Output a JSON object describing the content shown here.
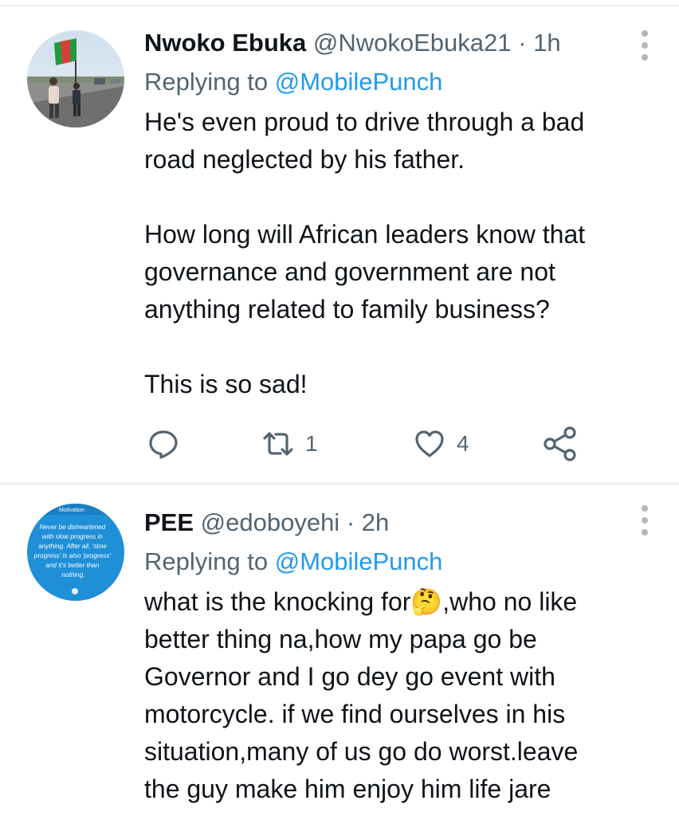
{
  "tweets": [
    {
      "display_name": "Nwoko Ebuka",
      "handle": "@NwokoEbuka21",
      "separator": "·",
      "time": "1h",
      "replying_prefix": "Replying to",
      "replying_to": "@MobilePunch",
      "lines": [
        "He's even proud to drive through a bad",
        "road neglected by his father.",
        "",
        "How long will African leaders know that",
        "governance and government are not",
        "anything related to family business?",
        "",
        "This is so sad!"
      ],
      "retweets": "1",
      "likes": "4",
      "icons": [
        "avatar-photo",
        "more-vertical-icon",
        "reply-icon",
        "retweet-icon",
        "like-icon",
        "share-icon"
      ]
    },
    {
      "display_name": "PEE",
      "handle": "@edoboyehi",
      "separator": "·",
      "time": "2h",
      "replying_prefix": "Replying to",
      "replying_to": "@MobilePunch",
      "lines": [
        "what is the knocking for🤔,who no like",
        "better thing na,how my papa go be",
        "Governor and I go dey go event with",
        "motorcycle. if we find ourselves in his",
        "situation,many of us go do worst.leave",
        "the guy make him enjoy him life jare"
      ],
      "avatar_text": {
        "label": "Motivation",
        "quote": "Never be disheartened with slow progress in anything. After all, 'slow progress' is also 'progress' and it's better than nothing."
      }
    }
  ],
  "colors": {
    "text": "#0f1419",
    "muted": "#536471",
    "link": "#1d9bf0",
    "divider": "#e6ecf0"
  }
}
